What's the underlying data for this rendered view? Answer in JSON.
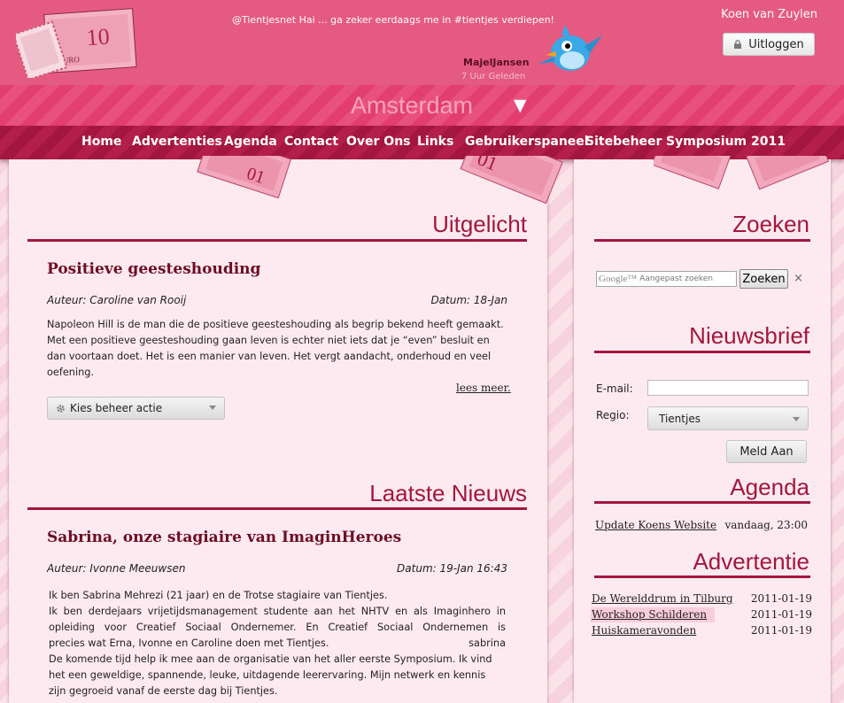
{
  "header": {
    "tweet": {
      "text": "@Tientjesnet Hai ... ga zeker eerdaags me in #tientjes verdiepen!",
      "user": "MajelJansen",
      "time": "7 Uur Geleden"
    },
    "username": "Koen van Zuylen",
    "logout_label": "Uitloggen",
    "city": "Amsterdam",
    "city_arrow": "▼"
  },
  "nav": {
    "items": [
      {
        "label": "Home"
      },
      {
        "label": "Advertenties"
      },
      {
        "label": "Agenda"
      },
      {
        "label": "Contact"
      },
      {
        "label": "Over Ons"
      },
      {
        "label": "Links"
      },
      {
        "label": "Gebruikerspaneel"
      },
      {
        "label": "Sitebeheer"
      },
      {
        "label": "Symposium 2011"
      }
    ]
  },
  "featured": {
    "section_title": "Uitgelicht",
    "title": "Positieve geesteshouding",
    "author": "Auteur: Caroline van Rooij",
    "date": "Datum: 18-Jan",
    "body": "Napoleon Hill is de man die de positieve geesteshouding als begrip bekend heeft gemaakt. Met een positieve geesteshouding gaan leven is echter niet iets dat je “even” besluit en dan voortaan doet. Het is een manier van leven. Het vergt aandacht, onderhoud en veel oefening.",
    "read_more": "lees meer.",
    "manage_label": "Kies beheer actie"
  },
  "news": {
    "section_title": "Laatste Nieuws",
    "title": "Sabrina, onze stagiaire van ImaginHeroes",
    "author": "Auteur: Ivonne Meeuwsen",
    "date": "Datum: 19-Jan 16:43",
    "lines": [
      "Ik ben Sabrina Mehrezi (21 jaar) en de Trotse stagiaire van Tientjes.",
      "Ik ben derdejaars vrijetijdsmanagement studente aan het NHTV en als Imaginhero in",
      "opleiding voor Creatief Sociaal Ondernemer. En Creatief Sociaal Ondernemen is",
      "precies wat Erna, Ivonne en Caroline doen met Tientjes.",
      "sabrina",
      "De komende tijd help ik mee aan de organisatie van het aller eerste Symposium. Ik vind",
      "het een geweldige, spannende, leuke, uitdagende leerervaring. Mijn netwerk en kennis",
      "zijn gegroeid vanaf de eerste dag bij Tientjes."
    ]
  },
  "sidebar": {
    "search": {
      "title": "Zoeken",
      "brand": "Google™",
      "placeholder": "Aangepast zoeken",
      "button": "Zoeken",
      "clear": "×"
    },
    "newsletter": {
      "title": "Nieuwsbrief",
      "email_label": "E-mail:",
      "region_label": "Regio:",
      "region_value": "Tientjes",
      "submit": "Meld Aan"
    },
    "agenda": {
      "title": "Agenda",
      "items": [
        {
          "title": "Update Koens Website",
          "when": "vandaag, 23:00"
        }
      ]
    },
    "ads": {
      "title": "Advertentie",
      "items": [
        {
          "title": "De Werelddrum in Tilburg",
          "date": "2011-01-19"
        },
        {
          "title": "Workshop Schilderen",
          "date": "2011-01-19"
        },
        {
          "title": "Huiskameravonden",
          "date": "2011-01-19"
        }
      ]
    }
  },
  "colors": {
    "header": "#e55a80",
    "nav": "#a3173e",
    "accent": "#a3173e",
    "panel": "#fde9f0"
  }
}
